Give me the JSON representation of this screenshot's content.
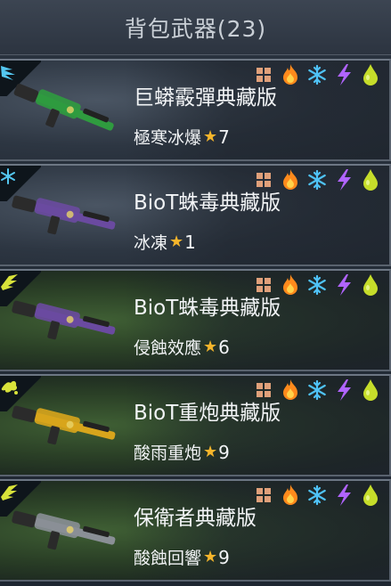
{
  "header": {
    "title": "背包武器(23)"
  },
  "weapons": [
    {
      "name": "巨蟒霰彈典藏版",
      "skill": "極寒冰爆",
      "level": "7",
      "bg": "grey",
      "corner_icon": "frost-wing-icon",
      "corner_color": "#54c7f0",
      "gun_color": "#2f9b3f"
    },
    {
      "name": "BioT蛛毒典藏版",
      "skill": "冰凍",
      "level": "1",
      "bg": "grey",
      "corner_icon": "snowflake-icon",
      "corner_color": "#54c7f0",
      "gun_color": "#6a4aa0"
    },
    {
      "name": "BioT蛛毒典藏版",
      "skill": "侵蝕效應",
      "level": "6",
      "bg": "green",
      "corner_icon": "acid-wing-icon",
      "corner_color": "#d8e23a",
      "gun_color": "#6a4aa0"
    },
    {
      "name": "BioT重炮典藏版",
      "skill": "酸雨重炮",
      "level": "9",
      "bg": "green",
      "corner_icon": "acid-splash-icon",
      "corner_color": "#d8e23a",
      "gun_color": "#d8a51c"
    },
    {
      "name": "保衛者典藏版",
      "skill": "酸蝕回響",
      "level": "9",
      "bg": "green",
      "corner_icon": "acid-wing-icon",
      "corner_color": "#d8e23a",
      "gun_color": "#8a8f96"
    }
  ],
  "element_icons": [
    "grid-icon",
    "fire-icon",
    "snowflake-icon",
    "lightning-icon",
    "acid-drop-icon"
  ],
  "colors": {
    "fire": "#ff8a1c",
    "frost": "#4fc3f7",
    "lightning": "#b164ff",
    "acid": "#c6dd2a",
    "grid": "#e0a07a",
    "star": "#f5b52b"
  }
}
